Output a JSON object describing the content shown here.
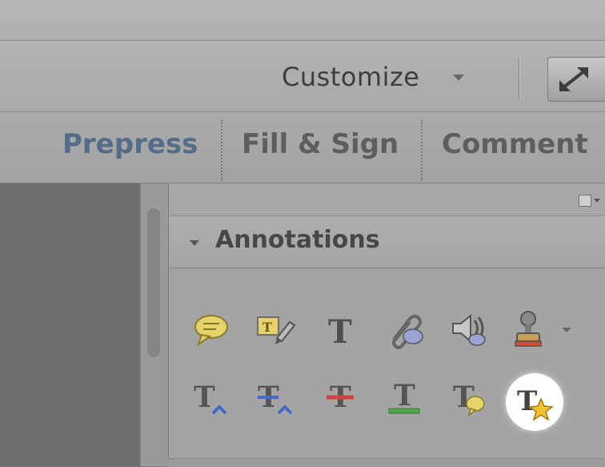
{
  "toolbar": {
    "customize_label": "Customize",
    "customize_dropdown_icon": "chevron-down-icon",
    "fullscreen_icon": "expand-arrows-icon"
  },
  "tabs": [
    {
      "label": "Prepress",
      "active": true
    },
    {
      "label": "Fill & Sign",
      "active": false
    },
    {
      "label": "Comment",
      "active": false
    }
  ],
  "panel": {
    "options_icon": "panel-options-icon",
    "section_title": "Annotations",
    "section_expanded": true
  },
  "annotation_tools": {
    "row1": [
      "sticky-note-icon",
      "text-edit-icon",
      "add-text-icon",
      "attach-file-icon",
      "record-audio-icon",
      "stamp-icon"
    ],
    "row2": [
      "insert-text-icon",
      "replace-text-icon",
      "strikethrough-icon",
      "underline-icon",
      "text-comment-icon",
      "text-correction-icon"
    ],
    "highlighted_tool": "text-correction-icon"
  },
  "colors": {
    "active_tab": "#536c8a",
    "inactive_tab": "#5e5e5e",
    "highlight": "#ffffff"
  }
}
